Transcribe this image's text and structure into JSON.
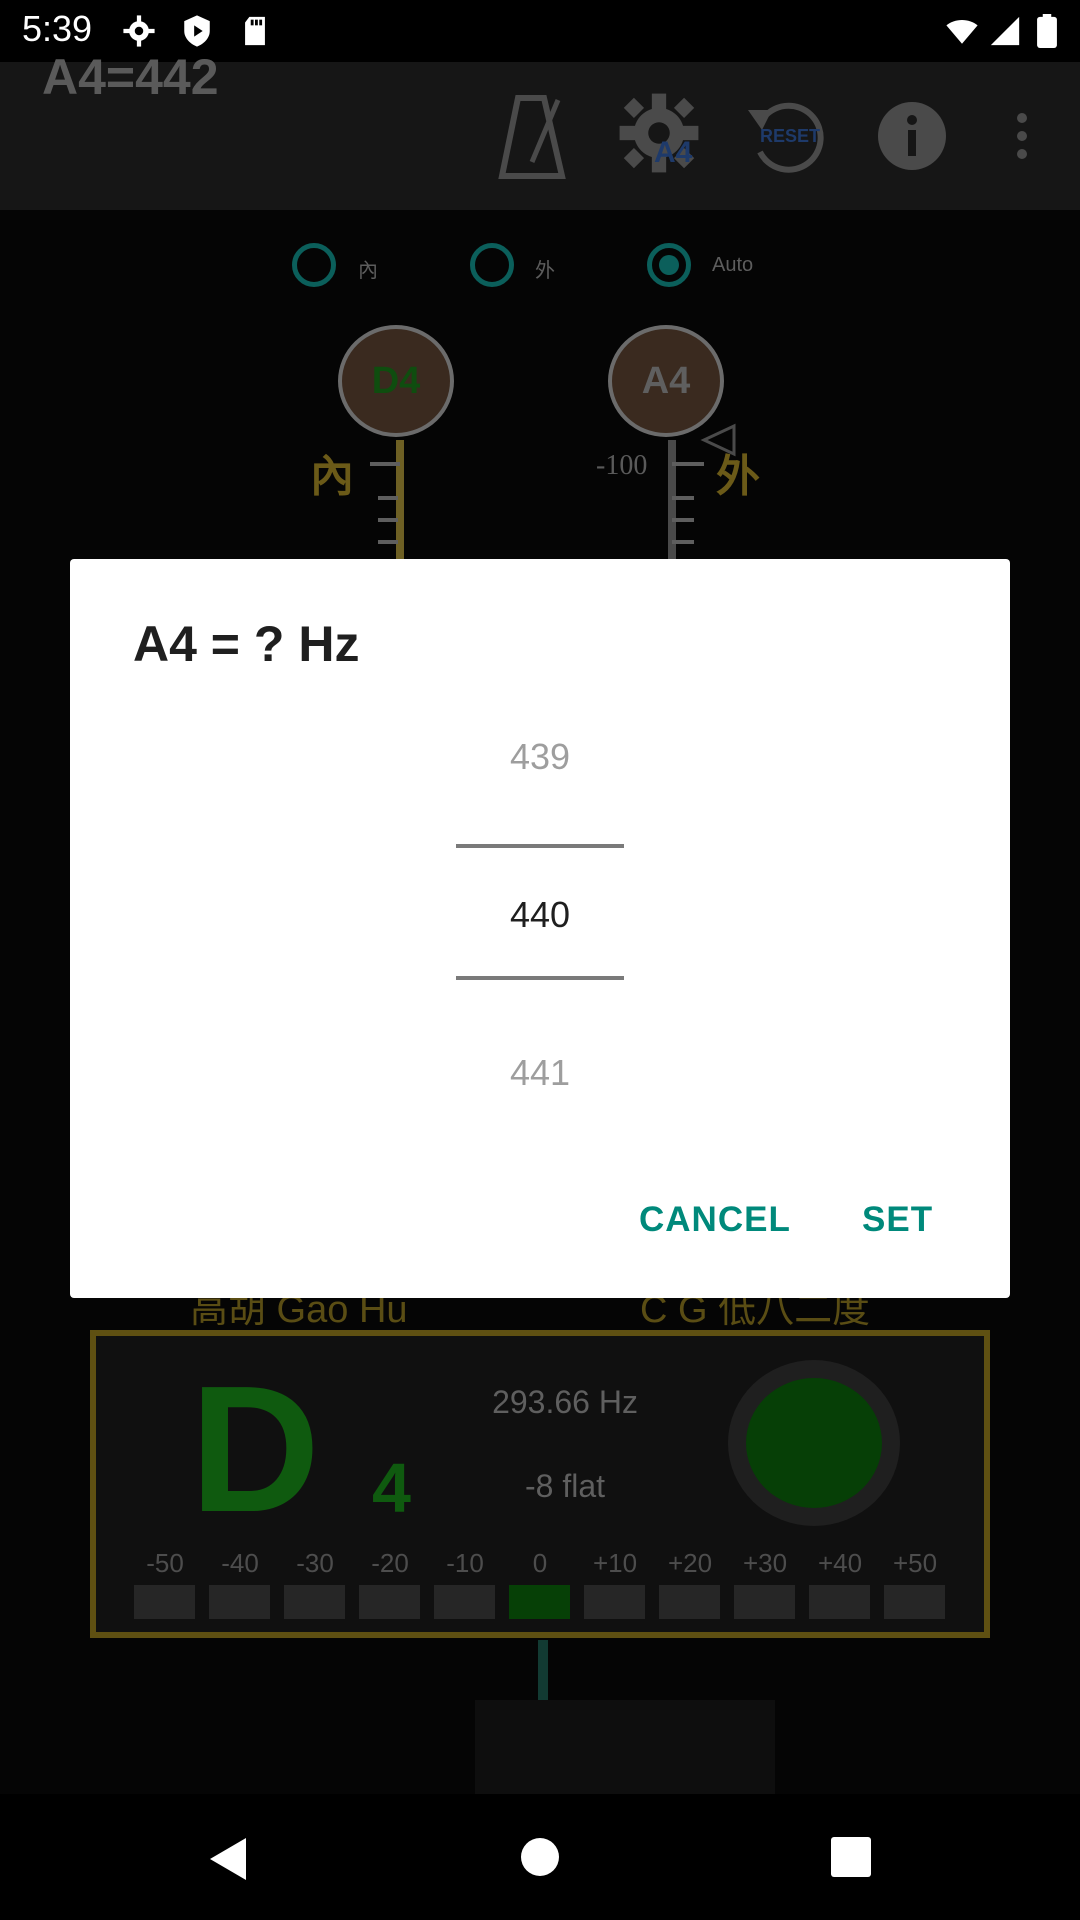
{
  "status_bar": {
    "time": "5:39"
  },
  "app_bar": {
    "title": "A4=442",
    "reset_label": "RESET",
    "gear_badge": "A4"
  },
  "mode_selector": {
    "options": [
      {
        "label": "內",
        "selected": false
      },
      {
        "label": "外",
        "selected": false
      },
      {
        "label": "Auto",
        "selected": true
      }
    ]
  },
  "strings": {
    "inner": {
      "note": "D4",
      "side_label": "內"
    },
    "outer": {
      "note": "A4",
      "side_label": "外",
      "scale_top": "-100"
    }
  },
  "instrument": {
    "name_left": "高胡 Gao Hu",
    "name_right": "C G 低八二度"
  },
  "tuner": {
    "note": "D",
    "octave": "4",
    "frequency": "293.66 Hz",
    "cents": "-8 flat",
    "meter_labels": [
      "-50",
      "-40",
      "-30",
      "-20",
      "-10",
      "0",
      "+10",
      "+20",
      "+30",
      "+40",
      "+50"
    ],
    "active_index": 5
  },
  "dialog": {
    "title": "A4 = ? Hz",
    "picker": {
      "previous": "439",
      "current": "440",
      "next": "441"
    },
    "cancel_label": "CANCEL",
    "set_label": "SET"
  },
  "colors": {
    "accent": "#00897B",
    "dim_overlay": "#000000"
  }
}
